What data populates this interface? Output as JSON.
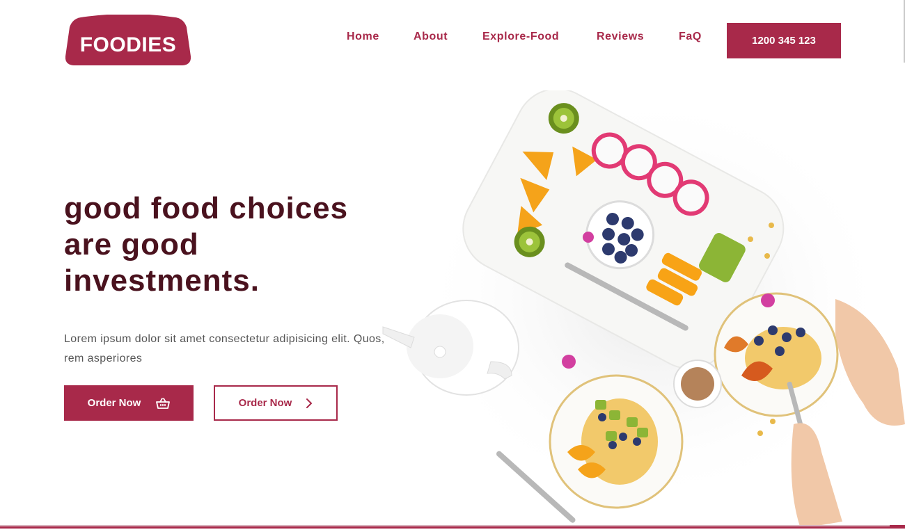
{
  "brand": {
    "name": "FOODIES"
  },
  "nav": {
    "items": [
      {
        "label": "Home"
      },
      {
        "label": "About"
      },
      {
        "label": "Explore-Food"
      },
      {
        "label": "Reviews"
      },
      {
        "label": "FaQ"
      }
    ],
    "phone": "1200 345 123"
  },
  "hero": {
    "title": "good food choices are good investments.",
    "description": "Lorem ipsum dolor sit amet consectetur adipisicing elit. Quos, rem asperiores",
    "primary_button": {
      "label": "Order Now",
      "icon": "basket-icon"
    },
    "secondary_button": {
      "label": "Order Now",
      "icon": "chevron-right-icon"
    }
  },
  "image": {
    "subject": "food-plates-photo"
  },
  "colors": {
    "accent": "#a8294a",
    "title": "#4a121e",
    "body_text": "#555555"
  }
}
